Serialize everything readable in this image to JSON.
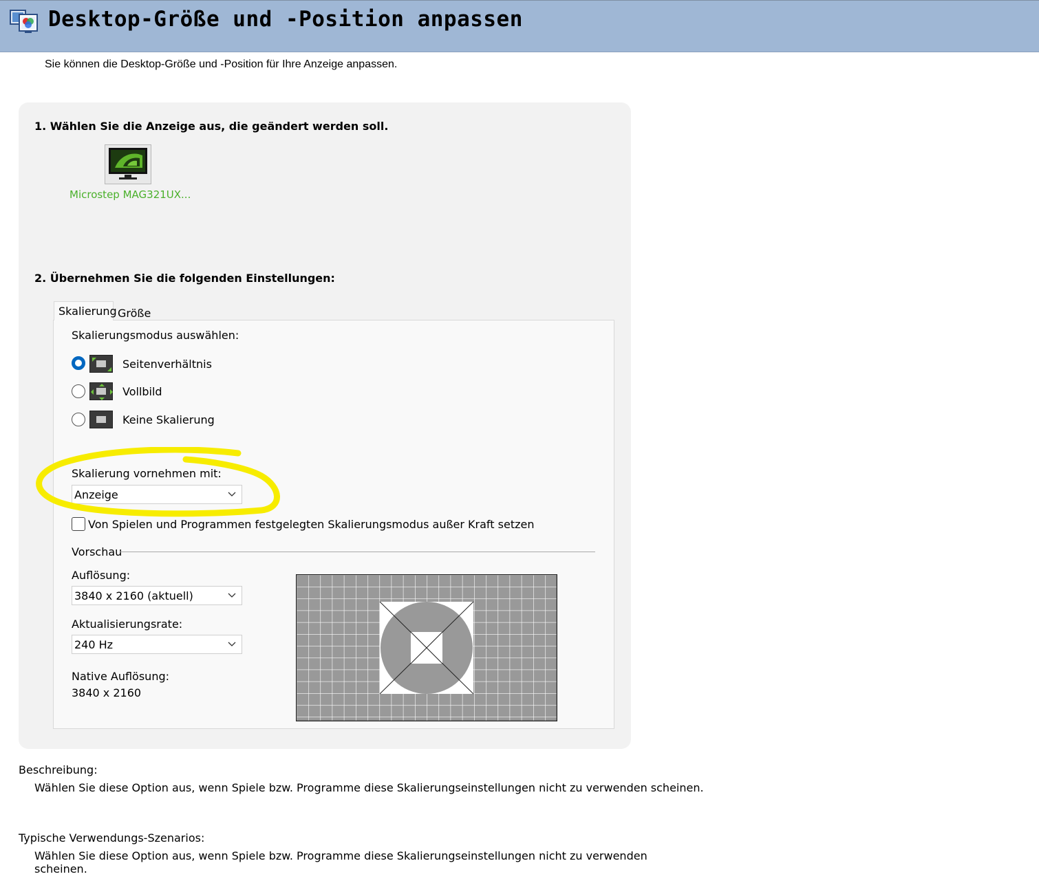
{
  "header": {
    "title": "Desktop-Größe und -Position anpassen",
    "icon": "display-settings-icon",
    "background_color": "#9fb7d5"
  },
  "subtitle": "Sie können die Desktop-Größe und -Position für Ihre Anzeige anpassen.",
  "step1": {
    "heading": "1. Wählen Sie die Anzeige aus, die geändert werden soll.",
    "display_name": "Microstep MAG321UX...",
    "display_icon": "nvidia-monitor-icon",
    "display_label_color": "#4ab02a"
  },
  "step2": {
    "heading": "2. Übernehmen Sie die folgenden Einstellungen:",
    "tabs": [
      {
        "label": "Skalierung",
        "active": true
      },
      {
        "label": "Größe",
        "active": false
      }
    ],
    "scaling_mode_label": "Skalierungsmodus auswählen:",
    "modes": [
      {
        "label": "Seitenverhältnis",
        "selected": true,
        "icon": "aspect-ratio-icon"
      },
      {
        "label": "Vollbild",
        "selected": false,
        "icon": "fullscreen-icon"
      },
      {
        "label": "Keine Skalierung",
        "selected": false,
        "icon": "no-scaling-icon"
      }
    ],
    "perform_scaling_label": "Skalierung vornehmen mit:",
    "perform_scaling_value": "Anzeige",
    "override_label": "Von Spielen und Programmen festgelegten Skalierungsmodus außer Kraft setzen",
    "override_checked": false,
    "preview_label": "Vorschau",
    "resolution_label": "Auflösung:",
    "resolution_value": "3840 x 2160 (aktuell)",
    "refresh_label": "Aktualisierungsrate:",
    "refresh_value": "240 Hz",
    "native_label": "Native Auflösung:",
    "native_value": "3840 x 2160",
    "highlight_color": "#f7ec00"
  },
  "description": {
    "heading": "Beschreibung:",
    "text": "Wählen Sie diese Option aus, wenn Spiele bzw. Programme diese Skalierungseinstellungen nicht zu verwenden scheinen."
  },
  "typical_usage": {
    "heading": "Typische Verwendungs-Szenarios:",
    "line1": "Wählen Sie diese Option aus, wenn Spiele bzw. Programme diese Skalierungseinstellungen nicht zu verwenden",
    "line2": "scheinen."
  }
}
